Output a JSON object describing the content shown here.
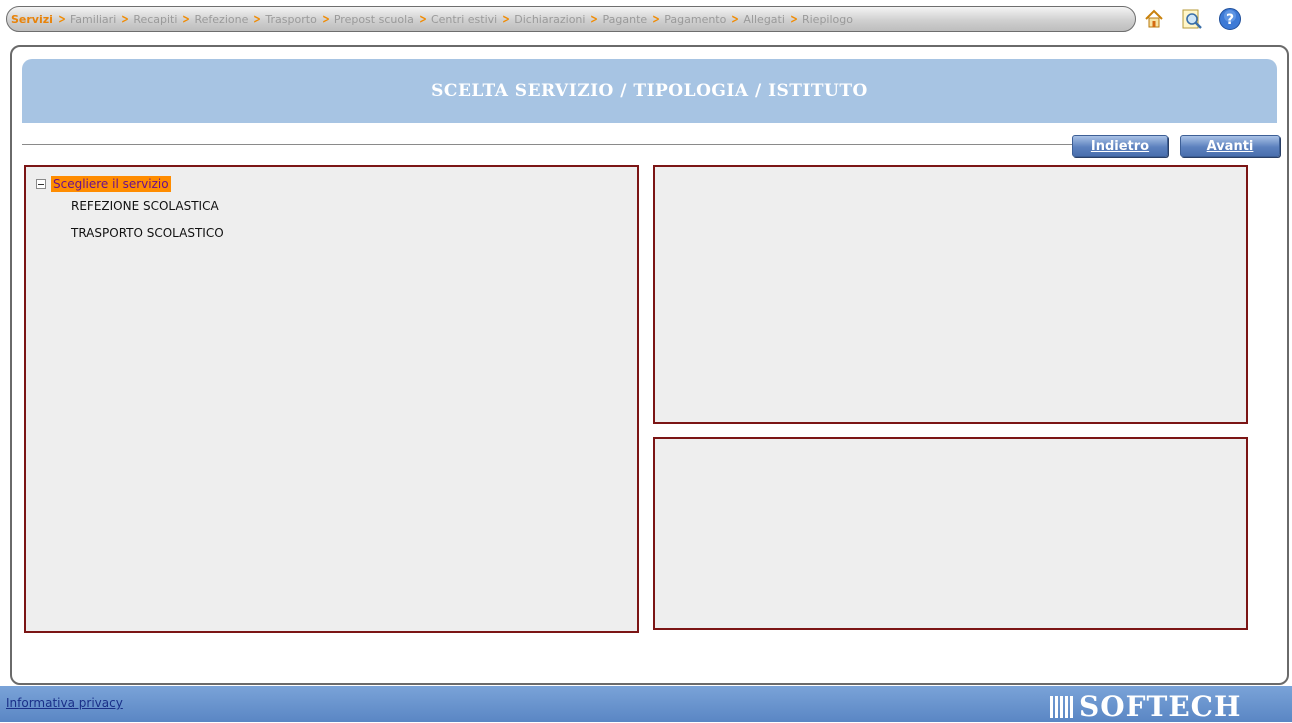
{
  "breadcrumb": {
    "items": [
      {
        "label": "Servizi",
        "active": true
      },
      {
        "label": "Familiari",
        "active": false
      },
      {
        "label": "Recapiti",
        "active": false
      },
      {
        "label": "Refezione",
        "active": false
      },
      {
        "label": "Trasporto",
        "active": false
      },
      {
        "label": "Prepost scuola",
        "active": false
      },
      {
        "label": "Centri estivi",
        "active": false
      },
      {
        "label": "Dichiarazioni",
        "active": false
      },
      {
        "label": "Pagante",
        "active": false
      },
      {
        "label": "Pagamento",
        "active": false
      },
      {
        "label": "Allegati",
        "active": false
      },
      {
        "label": "Riepilogo",
        "active": false
      }
    ],
    "separator": ">"
  },
  "top_icons": [
    "home-icon",
    "search-document-icon",
    "help-icon"
  ],
  "main": {
    "title": "SCELTA SERVIZIO / TIPOLOGIA / ISTITUTO",
    "back_button": "Indietro",
    "next_button": "Avanti",
    "tree": {
      "root_label": "Scegliere il servizio",
      "items": [
        "REFEZIONE SCOLASTICA",
        "TRASPORTO SCOLASTICO"
      ]
    }
  },
  "footer": {
    "privacy_link": "Informativa privacy",
    "logo": "SOFTECH"
  },
  "colors": {
    "accent_orange": "#f08a00",
    "title_blue": "#a7c4e3",
    "button_blue": "#5c81be",
    "panel_border": "#7b1515",
    "footer_blue": "#6a93cf"
  }
}
